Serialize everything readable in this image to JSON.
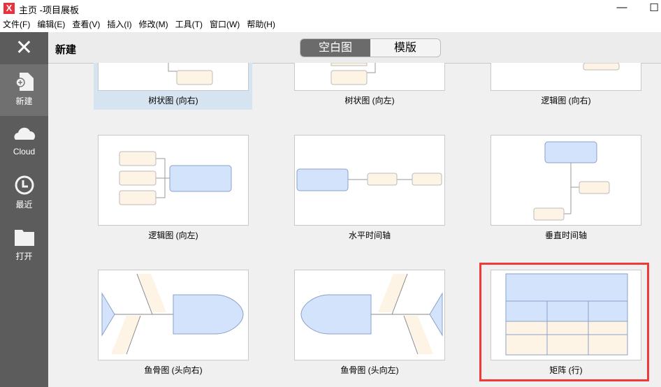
{
  "window": {
    "title": "主页 -项目展板",
    "logo": "X",
    "minimize": "—",
    "maximize": "☐"
  },
  "menu": [
    "文件(F)",
    "编辑(E)",
    "查看(V)",
    "插入(I)",
    "修改(M)",
    "工具(T)",
    "窗口(W)",
    "帮助(H)"
  ],
  "sidebar": {
    "close": "✕",
    "items": [
      {
        "label": "新建",
        "icon": "new-file-icon"
      },
      {
        "label": "Cloud",
        "icon": "cloud-icon"
      },
      {
        "label": "最近",
        "icon": "clock-icon"
      },
      {
        "label": "打开",
        "icon": "folder-icon"
      }
    ]
  },
  "header": {
    "title": "新建",
    "tabs": [
      "空白图",
      "模版"
    ],
    "active_tab": "空白图"
  },
  "templates": [
    "树状图 (向右)",
    "树状图 (向左)",
    "逻辑图 (向右)",
    "逻辑图 (向左)",
    "水平时间轴",
    "垂直时间轴",
    "鱼骨图 (头向右)",
    "鱼骨图 (头向左)",
    "矩阵 (行)"
  ],
  "colors": {
    "topic": "#d3e3fb",
    "subtopic": "#fdf4e6",
    "border": "#8aa0c8",
    "highlight": "#f03a3a"
  }
}
